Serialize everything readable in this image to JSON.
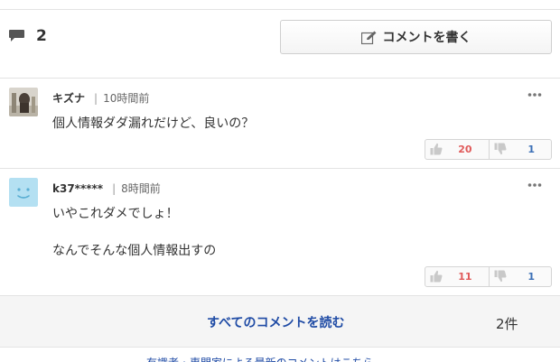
{
  "header": {
    "comment_count": "2",
    "write_button_label": "コメントを書く"
  },
  "comments": [
    {
      "user": "キズナ",
      "time": "10時間前",
      "lines": [
        "個人情報ダダ漏れだけど、良いの？"
      ],
      "likes": "20",
      "dislikes": "1"
    },
    {
      "user": "k37*****",
      "time": "8時間前",
      "lines": [
        "いやこれダメでしょ！",
        "なんでそんな個人情報出すの"
      ],
      "likes": "11",
      "dislikes": "1"
    }
  ],
  "read_all": {
    "label": "すべてのコメントを読む",
    "count": "2件"
  },
  "footer": {
    "partial_text": "有識者・専門家による最新のコメントはこちら"
  },
  "colors": {
    "link_blue": "#1f4ba5",
    "like_red": "#e05a5a",
    "dislike_blue": "#3b6fb6"
  },
  "icons": {
    "comment_count": "speech-bubble-icon",
    "write": "pen-icon",
    "more": "more-dots-icon",
    "like": "thumb-up-icon",
    "dislike": "thumb-down-icon"
  }
}
